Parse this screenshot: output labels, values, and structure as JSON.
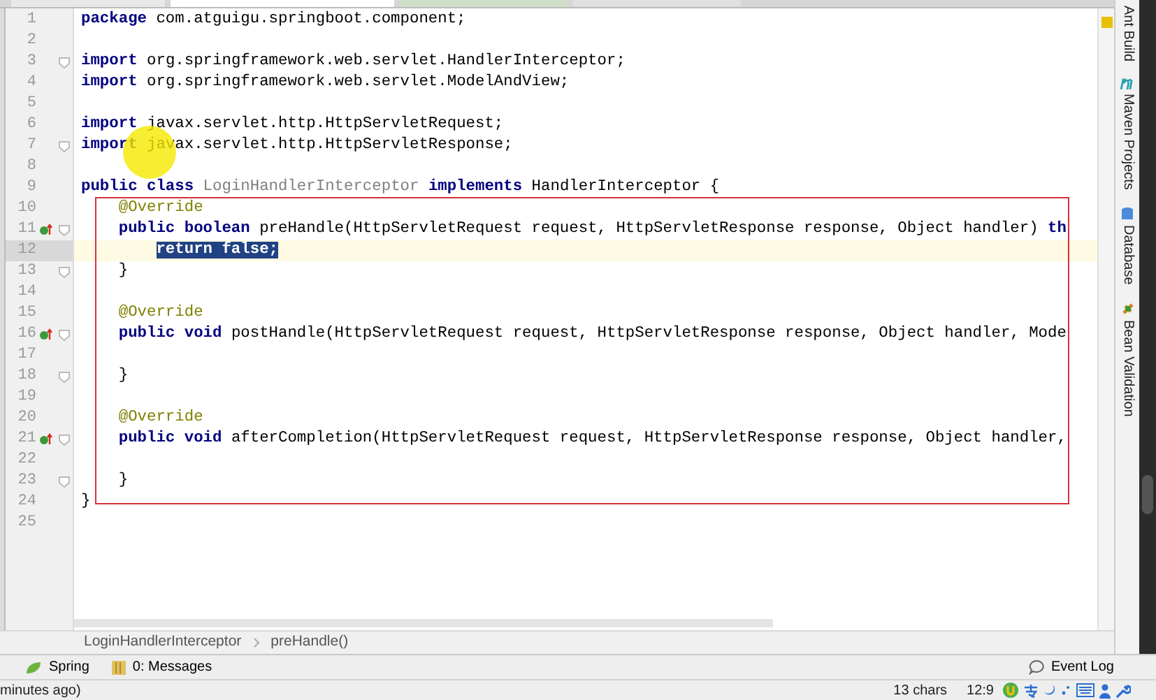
{
  "code_lines": [
    {
      "number": "1",
      "tokens": [
        {
          "kind": "keyword",
          "text": "package"
        },
        {
          "kind": "plain",
          "text": " com.atguigu.springboot.component;"
        }
      ]
    },
    {
      "number": "2"
    },
    {
      "number": "3",
      "fold": true,
      "tokens": [
        {
          "kind": "keyword",
          "text": "import"
        },
        {
          "kind": "plain",
          "text": " org.springframework.web.servlet.HandlerInterceptor;"
        }
      ]
    },
    {
      "number": "4",
      "tokens": [
        {
          "kind": "keyword",
          "text": "import"
        },
        {
          "kind": "plain",
          "text": " org.springframework.web.servlet.ModelAndView;"
        }
      ]
    },
    {
      "number": "5"
    },
    {
      "number": "6",
      "tokens": [
        {
          "kind": "keyword",
          "text": "import"
        },
        {
          "kind": "plain",
          "text": " javax.servlet.http.HttpServletRequest;"
        }
      ]
    },
    {
      "number": "7",
      "fold": true,
      "tokens": [
        {
          "kind": "keyword",
          "text": "import"
        },
        {
          "kind": "plain",
          "text": " javax.servlet.http.HttpServletResponse;"
        }
      ]
    },
    {
      "number": "8"
    },
    {
      "number": "9",
      "tokens": [
        {
          "kind": "keyword",
          "text": "public class"
        },
        {
          "kind": "unused",
          "text": " LoginHandlerInterceptor"
        },
        {
          "kind": "keyword",
          "text": " implements"
        },
        {
          "kind": "plain",
          "text": " HandlerInterceptor {"
        }
      ]
    },
    {
      "number": "10",
      "tokens": [
        {
          "kind": "annotation",
          "text": "    @Override"
        }
      ]
    },
    {
      "number": "11",
      "override_marker": true,
      "fold": true,
      "tokens": [
        {
          "kind": "keyword",
          "text": "    public boolean"
        },
        {
          "kind": "plain",
          "text": " preHandle(HttpServletRequest request, HttpServletResponse response, Object handler) "
        },
        {
          "kind": "keyword",
          "text": "th"
        }
      ]
    },
    {
      "number": "12",
      "current": true,
      "tokens": [
        {
          "kind": "selected",
          "text": "        return false;"
        }
      ]
    },
    {
      "number": "13",
      "fold": true,
      "tokens": [
        {
          "kind": "plain",
          "text": "    }"
        }
      ]
    },
    {
      "number": "14"
    },
    {
      "number": "15",
      "tokens": [
        {
          "kind": "annotation",
          "text": "    @Override"
        }
      ]
    },
    {
      "number": "16",
      "override_marker": true,
      "fold": true,
      "tokens": [
        {
          "kind": "keyword",
          "text": "    public void"
        },
        {
          "kind": "plain",
          "text": " postHandle(HttpServletRequest request, HttpServletResponse response, Object handler, Mode"
        }
      ]
    },
    {
      "number": "17"
    },
    {
      "number": "18",
      "fold": true,
      "tokens": [
        {
          "kind": "plain",
          "text": "    }"
        }
      ]
    },
    {
      "number": "19"
    },
    {
      "number": "20",
      "tokens": [
        {
          "kind": "annotation",
          "text": "    @Override"
        }
      ]
    },
    {
      "number": "21",
      "override_marker": true,
      "fold": true,
      "tokens": [
        {
          "kind": "keyword",
          "text": "    public void"
        },
        {
          "kind": "plain",
          "text": " afterCompletion(HttpServletRequest request, HttpServletResponse response, Object handler,"
        }
      ]
    },
    {
      "number": "22"
    },
    {
      "number": "23",
      "fold": true,
      "tokens": [
        {
          "kind": "plain",
          "text": "    }"
        }
      ]
    },
    {
      "number": "24",
      "tokens": [
        {
          "kind": "plain",
          "text": "}"
        }
      ]
    },
    {
      "number": "25"
    }
  ],
  "side_tools": [
    "Ant Build",
    "Maven Projects",
    "Database",
    "Bean Validation"
  ],
  "breadcrumb": [
    "LoginHandlerInterceptor",
    "preHandle()"
  ],
  "tool_windows": [
    {
      "kind": "spring",
      "label": "Spring"
    },
    {
      "kind": "messages",
      "label": "0: Messages"
    }
  ],
  "event_log": "Event Log",
  "status_bar": {
    "message": "minutes ago)",
    "selection": "13 chars",
    "position": "12:9"
  }
}
